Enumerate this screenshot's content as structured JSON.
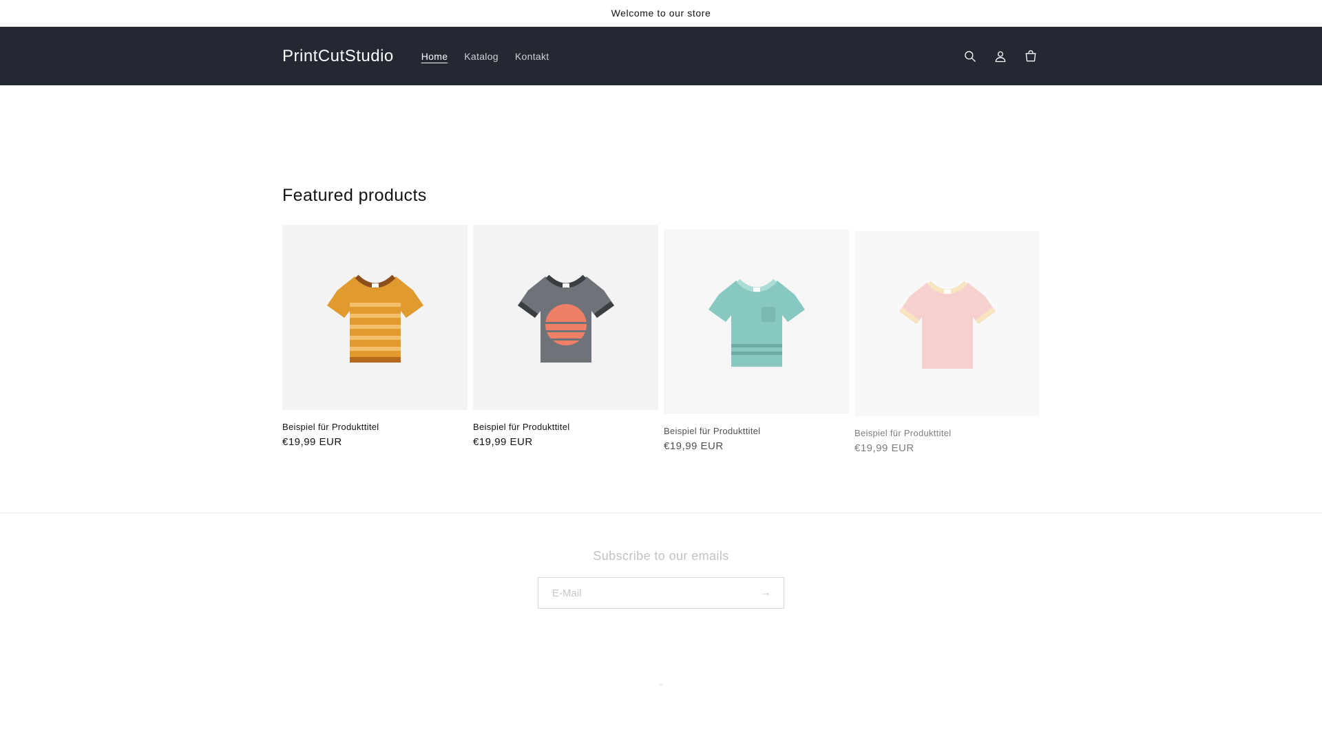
{
  "announcement": "Welcome to our store",
  "header": {
    "logo": "PrintCutStudio",
    "nav": [
      "Home",
      "Katalog",
      "Kontakt"
    ],
    "icons": [
      "search-icon",
      "account-icon",
      "cart-icon"
    ]
  },
  "featured": {
    "title": "Featured products",
    "products": [
      {
        "title": "Beispiel für Produkttitel",
        "price": "€19,99 EUR",
        "color": "#e19a2e"
      },
      {
        "title": "Beispiel für Produkttitel",
        "price": "€19,99 EUR",
        "color": "#6e7279"
      },
      {
        "title": "Beispiel für Produkttitel",
        "price": "€19,99 EUR",
        "color": "#5fb6ad"
      },
      {
        "title": "Beispiel für Produkttitel",
        "price": "€19,99 EUR",
        "color": "#f0a8a8"
      }
    ]
  },
  "subscribe": {
    "title": "Subscribe to our emails",
    "placeholder": "E-Mail"
  },
  "colors": {
    "header_bg": "#242833",
    "card_bg": "#f3f3f3"
  }
}
